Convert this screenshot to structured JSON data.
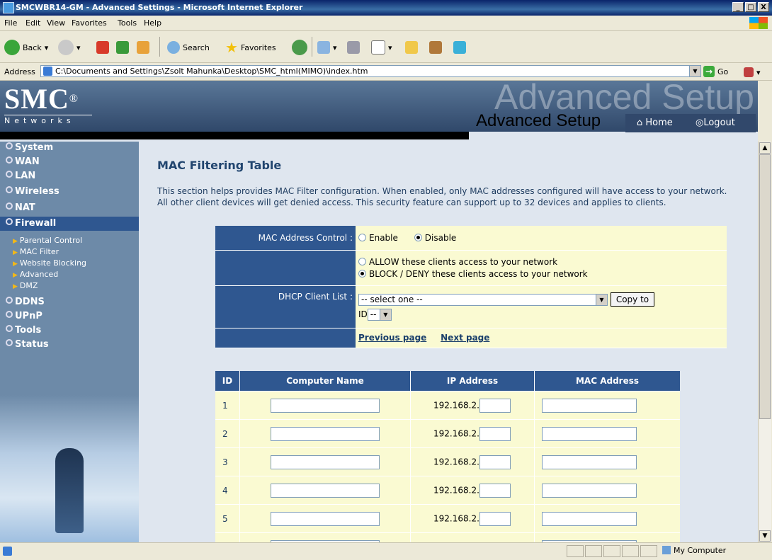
{
  "window": {
    "title": "SMCWBR14-GM - Advanced Settings - Microsoft Internet Explorer",
    "min": "_",
    "max": "□",
    "close": "X"
  },
  "menu": [
    "File",
    "Edit",
    "View",
    "Favorites",
    "Tools",
    "Help"
  ],
  "toolbar": {
    "back": "Back",
    "search": "Search",
    "favorites": "Favorites"
  },
  "address": {
    "label": "Address",
    "url": "C:\\Documents and Settings\\Zsolt Mahunka\\Desktop\\SMC_html(MIMO)\\index.htm",
    "go": "Go"
  },
  "header": {
    "logo": "SMC",
    "logo_reg": "®",
    "logo_sub": "Networks",
    "ghost_title": "Advanced Setup",
    "title": "Advanced Setup",
    "home": "Home",
    "logout": "Logout"
  },
  "sidebar": {
    "items": [
      "System",
      "WAN",
      "LAN",
      "Wireless",
      "NAT",
      "Firewall"
    ],
    "sub_items": [
      "Parental Control",
      "MAC Filter",
      "Website Blocking",
      "Advanced",
      "DMZ"
    ],
    "items_after": [
      "DDNS",
      "UPnP",
      "Tools",
      "Status"
    ]
  },
  "page": {
    "title": "MAC Filtering Table",
    "description": "This section helps provides MAC Filter configuration. When enabled, only MAC addresses configured will have access to your network. All other client devices will get denied access. This security feature can support up to 32 devices and applies to clients."
  },
  "config": {
    "mac_control_label": "MAC Address Control :",
    "enable": "Enable",
    "disable": "Disable",
    "allow": "ALLOW these clients access to your network",
    "block": "BLOCK / DENY these clients access to your network",
    "dhcp_label": "DHCP Client List :",
    "dhcp_select": "-- select one --",
    "copy_to": "Copy to",
    "id_label": "ID",
    "id_value": "--",
    "prev": "Previous page",
    "next": "Next page"
  },
  "mac_table": {
    "headers": [
      "ID",
      "Computer Name",
      "IP Address",
      "MAC Address"
    ],
    "ip_prefix": "192.168.2.",
    "rows": [
      "1",
      "2",
      "3",
      "4",
      "5"
    ]
  },
  "status": {
    "zone": "My Computer"
  }
}
